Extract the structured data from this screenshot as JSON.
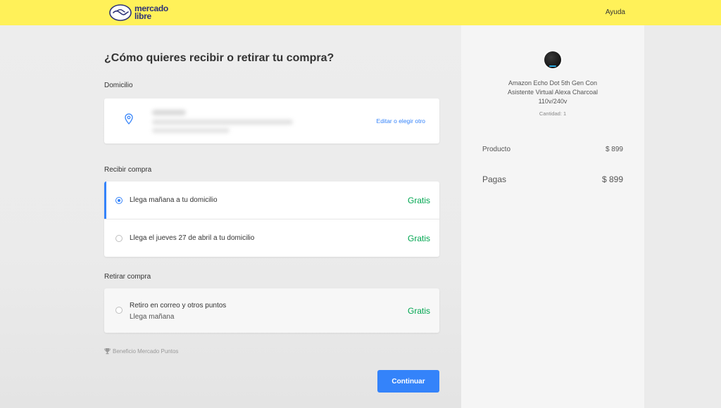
{
  "header": {
    "logo_line1": "mercado",
    "logo_line2": "libre",
    "help": "Ayuda"
  },
  "main": {
    "title": "¿Cómo quieres recibir o retirar tu compra?",
    "address_section_label": "Domicilio",
    "address_edit_link": "Editar o elegir otro",
    "receive_section_label": "Recibir compra",
    "receive_options": [
      {
        "label": "Llega mañana a tu domicilio",
        "price": "Gratis",
        "selected": true
      },
      {
        "label": "Llega el jueves 27 de abril a tu domicilio",
        "price": "Gratis",
        "selected": false
      }
    ],
    "pickup_section_label": "Retirar compra",
    "pickup_option": {
      "label": "Retiro en correo y otros puntos",
      "sublabel": "Llega mañana",
      "price": "Gratis",
      "selected": false
    },
    "benefit": "Beneficio Mercado Puntos",
    "continue_button": "Continuar"
  },
  "sidebar": {
    "product_name": "Amazon Echo Dot 5th Gen Con Asistente Virtual Alexa Charcoal 110v/240v",
    "quantity": "Cantidad: 1",
    "product_label": "Producto",
    "product_price": "$ 899",
    "total_label": "Pagas",
    "total_price": "$ 899"
  },
  "colors": {
    "header_yellow": "#fff159",
    "accent_blue": "#3483fa",
    "free_green": "#00a650"
  }
}
